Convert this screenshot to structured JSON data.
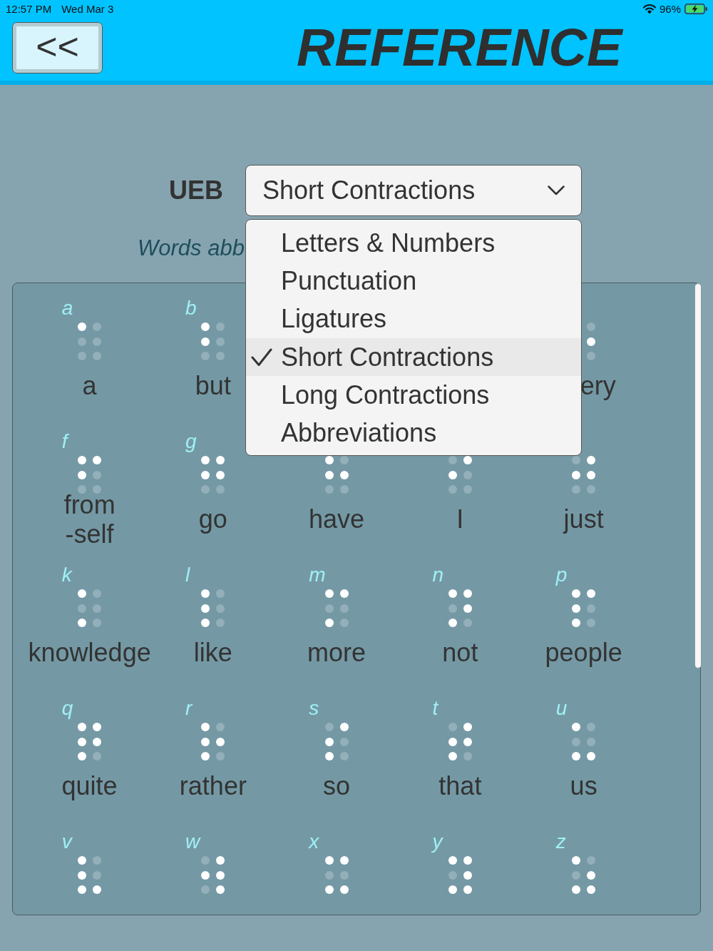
{
  "status_bar": {
    "time": "12:57 PM",
    "date": "Wed Mar 3",
    "battery": "96%"
  },
  "header": {
    "back_button": "<<",
    "title": "REFERENCE"
  },
  "category_select": {
    "label": "UEB",
    "value": "Short Contractions",
    "options": [
      {
        "label": "Letters & Numbers",
        "selected": false
      },
      {
        "label": "Punctuation",
        "selected": false
      },
      {
        "label": "Ligatures",
        "selected": false
      },
      {
        "label": "Short Contractions",
        "selected": true
      },
      {
        "label": "Long Contractions",
        "selected": false
      },
      {
        "label": "Abbreviations",
        "selected": false
      }
    ]
  },
  "description": "Words abb",
  "cells": [
    {
      "kind": "full",
      "letter": "a",
      "dots": [
        true,
        false,
        false,
        false,
        false,
        false
      ],
      "word": "a"
    },
    {
      "kind": "full",
      "letter": "b",
      "dots": [
        true,
        true,
        false,
        false,
        false,
        false
      ],
      "word": "but"
    },
    {
      "kind": "covered"
    },
    {
      "kind": "covered"
    },
    {
      "kind": "partial",
      "dots": [
        false,
        true,
        false
      ],
      "word": "ery"
    },
    {
      "kind": "full",
      "letter": "f",
      "dots": [
        true,
        true,
        false,
        true,
        false,
        false
      ],
      "word": "from\n-self"
    },
    {
      "kind": "full",
      "letter": "g",
      "dots": [
        true,
        true,
        false,
        true,
        true,
        false
      ],
      "word": "go"
    },
    {
      "kind": "full",
      "dots": [
        true,
        true,
        false,
        false,
        true,
        false
      ],
      "word": "have"
    },
    {
      "kind": "full",
      "dots": [
        false,
        true,
        false,
        true,
        false,
        false
      ],
      "word": "I"
    },
    {
      "kind": "full",
      "dots": [
        false,
        true,
        false,
        true,
        true,
        false
      ],
      "word": "just"
    },
    {
      "kind": "full",
      "letter": "k",
      "dots": [
        true,
        false,
        true,
        false,
        false,
        false
      ],
      "word": "knowledge"
    },
    {
      "kind": "full",
      "letter": "l",
      "dots": [
        true,
        true,
        true,
        false,
        false,
        false
      ],
      "word": "like"
    },
    {
      "kind": "full",
      "letter": "m",
      "dots": [
        true,
        false,
        true,
        true,
        false,
        false
      ],
      "word": "more"
    },
    {
      "kind": "full",
      "letter": "n",
      "dots": [
        true,
        false,
        true,
        true,
        true,
        false
      ],
      "word": "not"
    },
    {
      "kind": "full",
      "letter": "p",
      "dots": [
        true,
        true,
        true,
        true,
        false,
        false
      ],
      "word": "people"
    },
    {
      "kind": "full",
      "letter": "q",
      "dots": [
        true,
        true,
        true,
        true,
        true,
        false
      ],
      "word": "quite"
    },
    {
      "kind": "full",
      "letter": "r",
      "dots": [
        true,
        true,
        true,
        false,
        true,
        false
      ],
      "word": "rather"
    },
    {
      "kind": "full",
      "letter": "s",
      "dots": [
        false,
        true,
        true,
        true,
        false,
        false
      ],
      "word": "so"
    },
    {
      "kind": "full",
      "letter": "t",
      "dots": [
        false,
        true,
        true,
        true,
        true,
        false
      ],
      "word": "that"
    },
    {
      "kind": "full",
      "letter": "u",
      "dots": [
        true,
        false,
        true,
        false,
        false,
        true
      ],
      "word": "us"
    },
    {
      "kind": "full",
      "letter": "v",
      "dots": [
        true,
        true,
        true,
        false,
        false,
        true
      ]
    },
    {
      "kind": "full",
      "letter": "w",
      "dots": [
        false,
        true,
        false,
        true,
        true,
        true
      ]
    },
    {
      "kind": "full",
      "letter": "x",
      "dots": [
        true,
        false,
        true,
        true,
        false,
        true
      ]
    },
    {
      "kind": "full",
      "letter": "y",
      "dots": [
        true,
        false,
        true,
        true,
        true,
        true
      ]
    },
    {
      "kind": "full",
      "letter": "z",
      "dots": [
        true,
        false,
        true,
        false,
        true,
        true
      ]
    }
  ]
}
